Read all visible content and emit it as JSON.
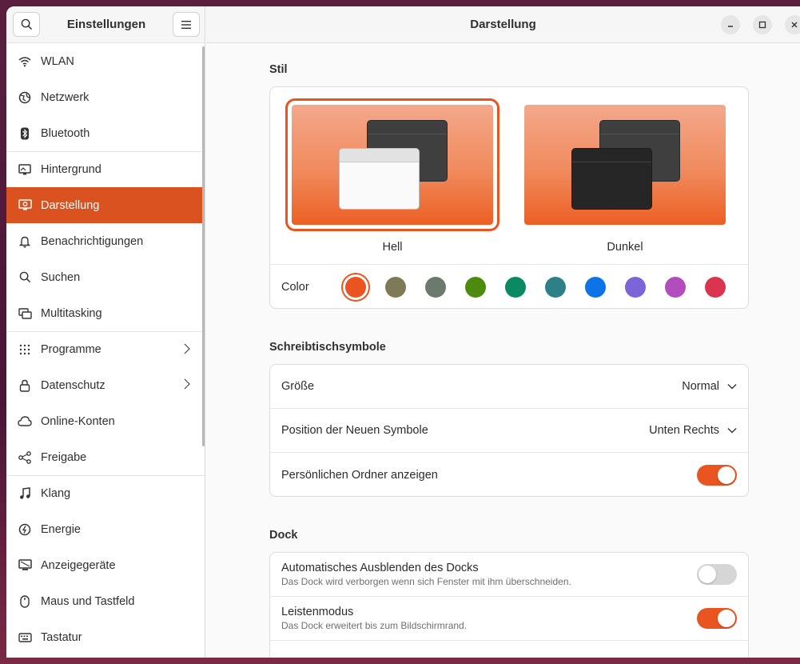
{
  "sidebar": {
    "title": "Einstellungen",
    "items": [
      {
        "label": "WLAN",
        "icon": "wifi-icon"
      },
      {
        "label": "Netzwerk",
        "icon": "globe-icon"
      },
      {
        "label": "Bluetooth",
        "icon": "bluetooth-icon"
      },
      {
        "label": "Hintergrund",
        "icon": "monitor-icon"
      },
      {
        "label": "Darstellung",
        "icon": "appearance-icon",
        "active": true
      },
      {
        "label": "Benachrichtigungen",
        "icon": "bell-icon"
      },
      {
        "label": "Suchen",
        "icon": "search-icon"
      },
      {
        "label": "Multitasking",
        "icon": "multitasking-icon"
      },
      {
        "label": "Programme",
        "icon": "grid-icon"
      },
      {
        "label": "Datenschutz",
        "icon": "lock-icon"
      },
      {
        "label": "Online-Konten",
        "icon": "cloud-icon"
      },
      {
        "label": "Freigabe",
        "icon": "share-icon"
      },
      {
        "label": "Klang",
        "icon": "music-note-icon"
      },
      {
        "label": "Energie",
        "icon": "power-icon"
      },
      {
        "label": "Anzeigegeräte",
        "icon": "display-icon"
      },
      {
        "label": "Maus und Tastfeld",
        "icon": "mouse-icon"
      },
      {
        "label": "Tastatur",
        "icon": "keyboard-icon"
      }
    ]
  },
  "main": {
    "title": "Darstellung",
    "style_section": {
      "title": "Stil",
      "light_label": "Hell",
      "dark_label": "Dunkel",
      "color_label": "Color",
      "colors": [
        "#e95420",
        "#7e7a55",
        "#6c7a6e",
        "#4e8a0e",
        "#0b8a62",
        "#2d8088",
        "#0e73e6",
        "#7c65d8",
        "#b34cbd",
        "#da3450"
      ]
    },
    "desktop_icons": {
      "title": "Schreibtischsymbole",
      "size_label": "Größe",
      "size_value": "Normal",
      "position_label": "Position der Neuen Symbole",
      "position_value": "Unten Rechts",
      "home_label": "Persönlichen Ordner anzeigen",
      "home_on": true
    },
    "dock": {
      "title": "Dock",
      "autohide_label": "Automatisches Ausblenden des Docks",
      "autohide_sub": "Das Dock wird verborgen wenn sich Fenster mit ihm überschneiden.",
      "autohide_on": false,
      "panel_label": "Leistenmodus",
      "panel_sub": "Das Dock erweitert bis zum Bildschirmrand.",
      "panel_on": true
    }
  },
  "accent_color": "#e95420"
}
